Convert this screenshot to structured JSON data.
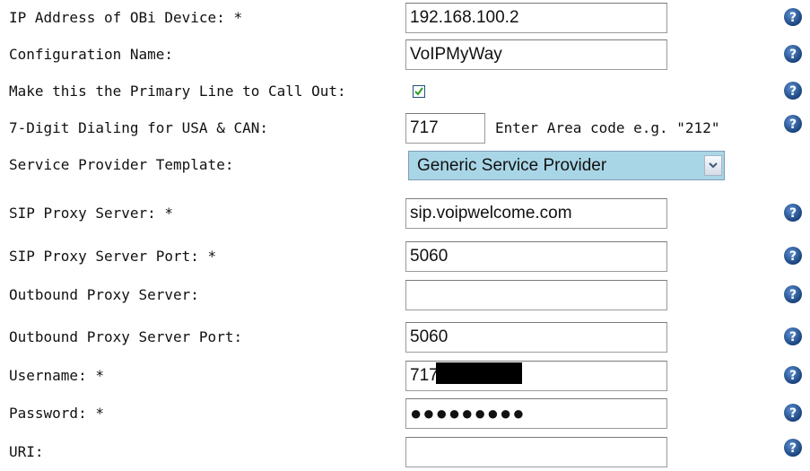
{
  "form": {
    "ip": {
      "label": "IP Address of OBi Device: *",
      "value": "192.168.100.2"
    },
    "config_name": {
      "label": "Configuration Name:",
      "value": "VoIPMyWay"
    },
    "primary_line": {
      "label": "Make this the Primary Line to Call Out:",
      "checked": true
    },
    "seven_digit": {
      "label": "7-Digit Dialing for USA & CAN:",
      "value": "717",
      "hint": "Enter Area code e.g. \"212\""
    },
    "provider_template": {
      "label": "Service Provider Template:",
      "selected": "Generic Service Provider"
    },
    "sip_proxy": {
      "label": "SIP Proxy Server: *",
      "value": "sip.voipwelcome.com"
    },
    "sip_proxy_port": {
      "label": "SIP Proxy Server Port: *",
      "value": "5060"
    },
    "outbound_proxy": {
      "label": "Outbound Proxy Server:",
      "value": ""
    },
    "outbound_proxy_port": {
      "label": "Outbound Proxy Server Port:",
      "value": "5060"
    },
    "username": {
      "label": "Username: *",
      "value": "717"
    },
    "password": {
      "label": "Password: *",
      "masked": "●●●●●●●●●"
    },
    "uri": {
      "label": "URI:",
      "value": ""
    }
  },
  "icons": {
    "help": "help-question-icon",
    "checkbox": "checkmark-icon",
    "dropdown": "chevron-down-icon"
  },
  "colors": {
    "help_icon": "#1f4f8f",
    "select_bg": "#a9d6e6",
    "checkmark": "#2a9d1f"
  }
}
